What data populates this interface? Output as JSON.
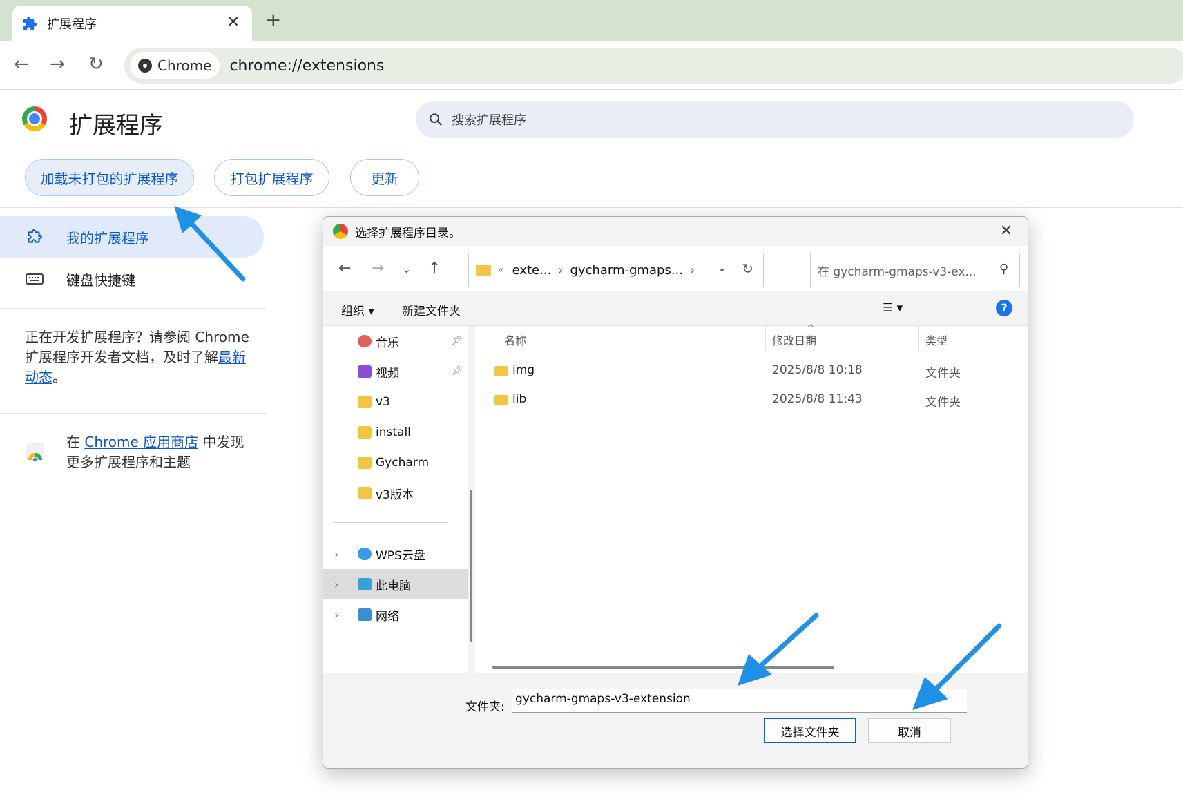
{
  "tab": {
    "title": "扩展程序",
    "close": "✕",
    "new_tab": "+"
  },
  "toolbar": {
    "back": "←",
    "forward": "→",
    "reload": "↻",
    "chip_label": "Chrome",
    "url": "chrome://extensions"
  },
  "page": {
    "title": "扩展程序",
    "search_placeholder": "搜索扩展程序",
    "buttons": [
      "加载未打包的扩展程序",
      "打包扩展程序",
      "更新"
    ]
  },
  "sidebar": {
    "items": [
      {
        "label": "我的扩展程序",
        "active": true
      },
      {
        "label": "键盘快捷键",
        "active": false
      }
    ],
    "dev_text_1": "正在开发扩展程序？请参阅 Chrome 扩展程序开发者文档，及时了解",
    "dev_link": "最新动态",
    "dev_text_2": "。",
    "store_prefix": "在 ",
    "store_link": "Chrome 应用商店",
    "store_suffix": " 中发现更多扩展程序和主题"
  },
  "dialog": {
    "title": "选择扩展程序目录。",
    "close": "✕",
    "path_prefix": "«",
    "path_1": "exte...",
    "path_2": "gycharm-gmaps...",
    "search_placeholder": "在 gycharm-gmaps-v3-ex...",
    "organize": "组织 ▾",
    "new_folder": "新建文件夹",
    "view": "☰ ▾",
    "help": "?",
    "tree": [
      {
        "label": "音乐",
        "color": "#e0605a",
        "pinned": true
      },
      {
        "label": "视频",
        "color": "#8a4fd6",
        "pinned": true
      },
      {
        "label": "v3",
        "color": "#f4c542",
        "pinned": false
      },
      {
        "label": "install",
        "color": "#f4c542",
        "pinned": false
      },
      {
        "label": "Gycharm",
        "color": "#f4c542",
        "pinned": false
      },
      {
        "label": "v3版本",
        "color": "#f4c542",
        "pinned": false
      }
    ],
    "tree_bottom": [
      {
        "label": "WPS云盘",
        "color": "#3a9be8"
      },
      {
        "label": "此电脑",
        "color": "#3aa0d8"
      },
      {
        "label": "网络",
        "color": "#3a8fd0"
      }
    ],
    "columns": [
      "名称",
      "修改日期",
      "类型"
    ],
    "files": [
      {
        "name": "img",
        "date": "2025/8/8 10:18",
        "type": "文件夹"
      },
      {
        "name": "lib",
        "date": "2025/8/8 11:43",
        "type": "文件夹"
      }
    ],
    "folder_label": "文件夹:",
    "folder_value": "gycharm-gmaps-v3-extension",
    "ok": "选择文件夹",
    "cancel": "取消"
  },
  "colors": {
    "accent": "#0b57d0",
    "tabstrip": "#d3e3cf",
    "arrow": "#1f8fe8"
  }
}
